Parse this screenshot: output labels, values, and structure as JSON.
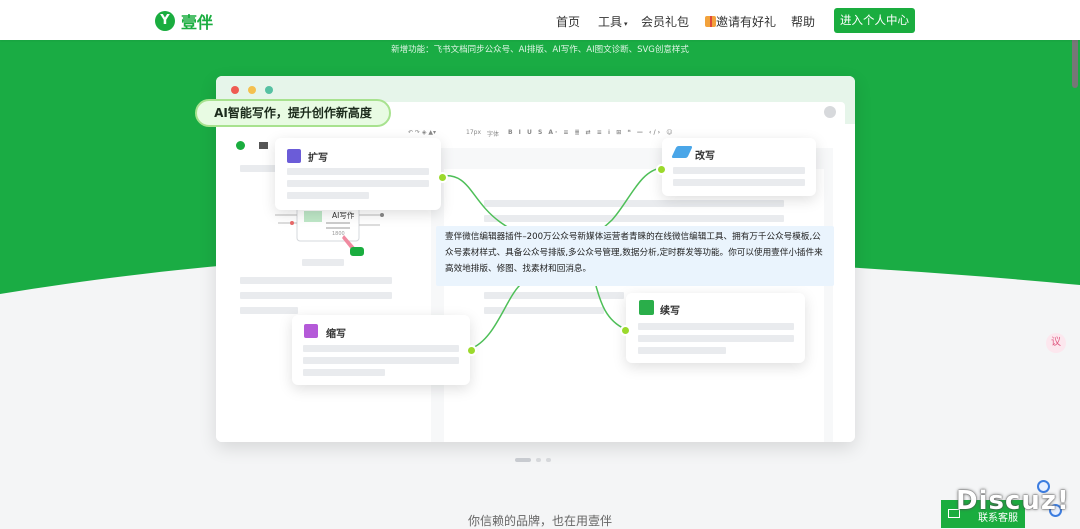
{
  "header": {
    "logo_text": "壹伴",
    "logo_mark": "Y",
    "nav": [
      {
        "label": "首页",
        "active": true
      },
      {
        "label": "工具",
        "has_dropdown": true
      },
      {
        "label": "会员礼包"
      },
      {
        "label": "邀请有好礼",
        "icon": "gift-icon"
      },
      {
        "label": "帮助"
      }
    ],
    "cta_label": "进入个人中心"
  },
  "hero": {
    "new_features": "新增功能：飞书文档同步公众号、AI排版、AI写作、AI图文诊断、SVG创意样式",
    "badge": "AI智能写作，提升创作新高度",
    "center_text": "壹伴微信编辑器插件–200万公众号新媒体运营者青睐的在线微信编辑工具、拥有万千公众号模板,公众号素材样式、具备公众号排版,多公众号管理,数据分析,定时群发等功能。你可以使用壹伴小插件来高效地排版、修图、找素材和回消息。",
    "ai_writing_label": "AI写作",
    "cards": {
      "expand": "扩写",
      "rewrite": "改写",
      "shorten": "缩写",
      "continue": "续写"
    },
    "toolbar": {
      "font_size": "17px",
      "font": "字体"
    }
  },
  "carousel_slides": 3,
  "carousel_active": 1,
  "trust_text": "你信赖的品牌，也在用壹伴",
  "float_button": "议",
  "contact_label": "联系客服",
  "watermark": "Discuz!",
  "colors": {
    "brand": "#1aad3f",
    "hero": "#1aac44"
  }
}
